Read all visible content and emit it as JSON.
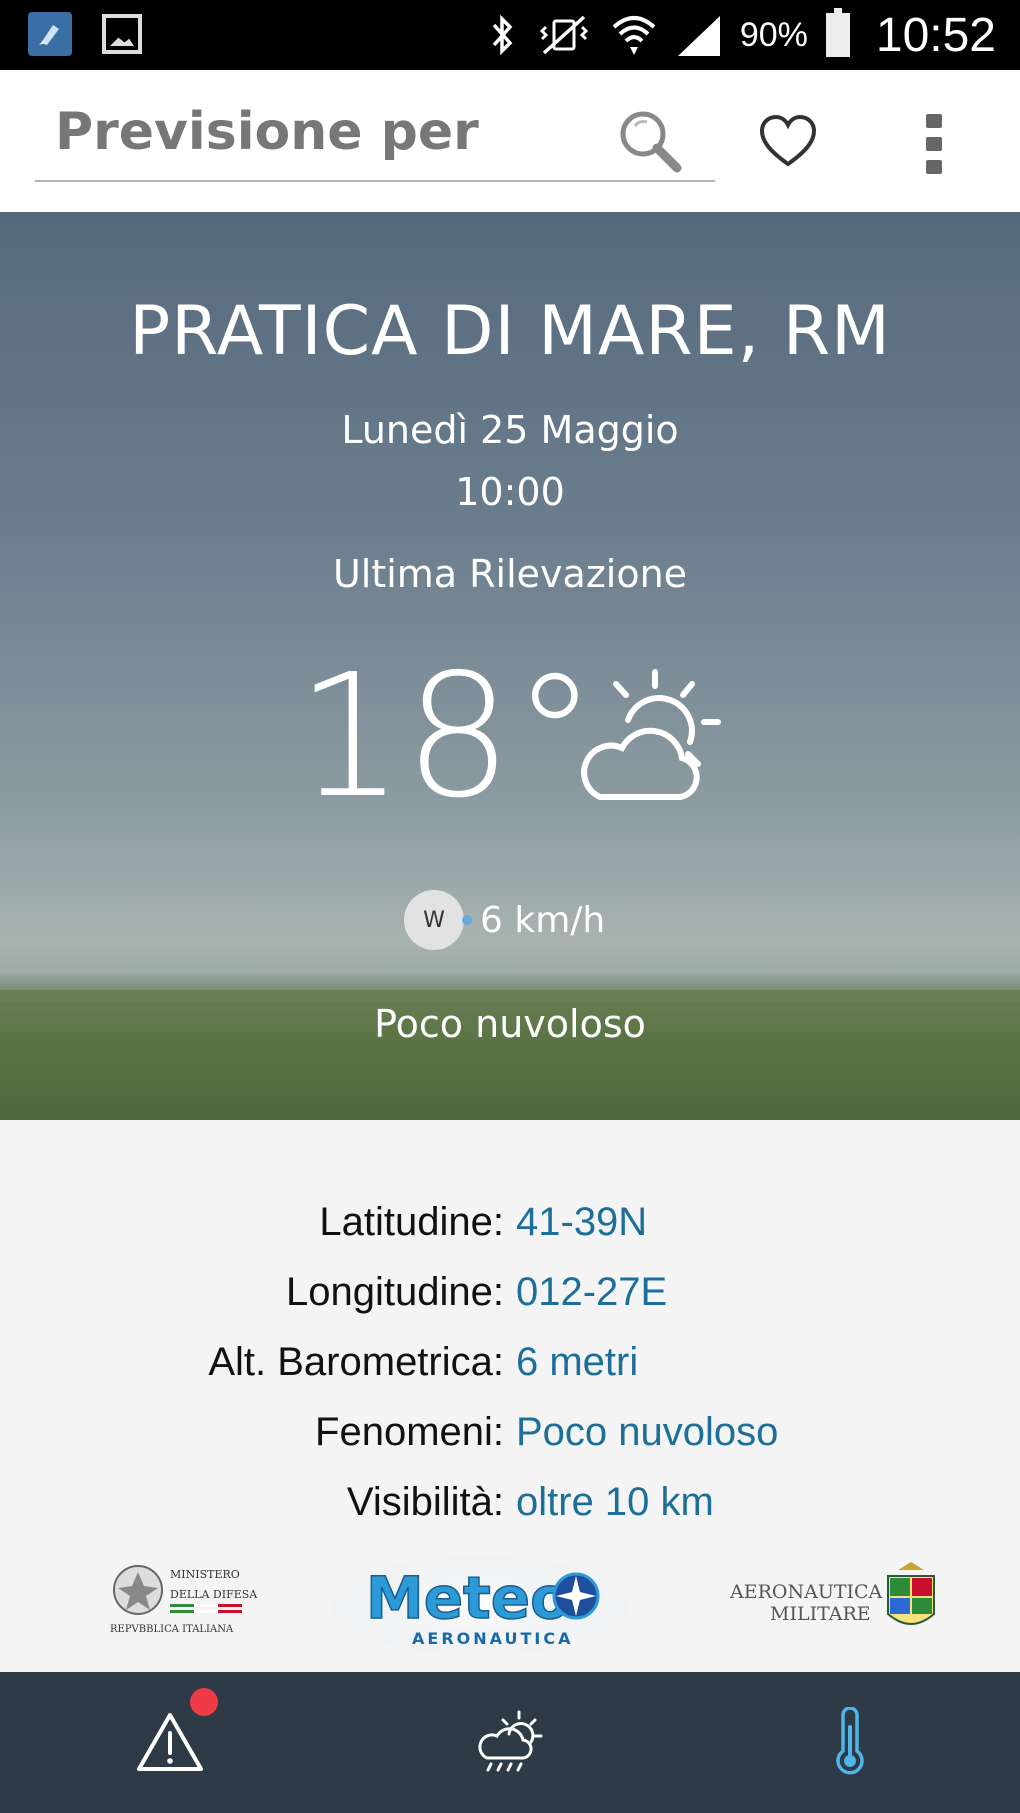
{
  "status_bar": {
    "battery": "90%",
    "time": "10:52"
  },
  "toolbar": {
    "search_placeholder": "Previsione per"
  },
  "hero": {
    "city": "PRATICA DI MARE, RM",
    "date": "Lunedì 25 Maggio",
    "time": "10:00",
    "label": "Ultima Rilevazione",
    "temperature": "18°",
    "wind_direction": "W",
    "wind_speed": "6 km/h",
    "condition": "Poco nuvoloso",
    "condition_icon": "partly-cloudy-icon"
  },
  "details": [
    {
      "label": "Latitudine:",
      "value": "41-39N"
    },
    {
      "label": "Longitudine:",
      "value": "012-27E"
    },
    {
      "label": "Alt. Barometrica:",
      "value": "6 metri"
    },
    {
      "label": "Fenomeni:",
      "value": "Poco nuvoloso"
    },
    {
      "label": "Visibilità:",
      "value": "oltre 10 km"
    }
  ],
  "logos": {
    "ministero_line1": "MINISTERO",
    "ministero_line2": "DELLA DIFESA",
    "ministero_line3": "REPVBBLICA ITALIANA",
    "meteo_title": "Meteo",
    "meteo_sub": "AERONAUTICA",
    "am_line1": "AERONAUTICA",
    "am_line2": "MILITARE"
  },
  "bottom_nav": [
    {
      "icon": "warning-icon",
      "has_badge": true
    },
    {
      "icon": "forecast-icon",
      "has_badge": false
    },
    {
      "icon": "thermometer-icon",
      "has_badge": false,
      "active": true
    }
  ],
  "colors": {
    "accent": "#1d6f99",
    "nav_bg": "#2f3a47",
    "badge": "#ef3b46",
    "thermometer": "#4fb6e8"
  }
}
